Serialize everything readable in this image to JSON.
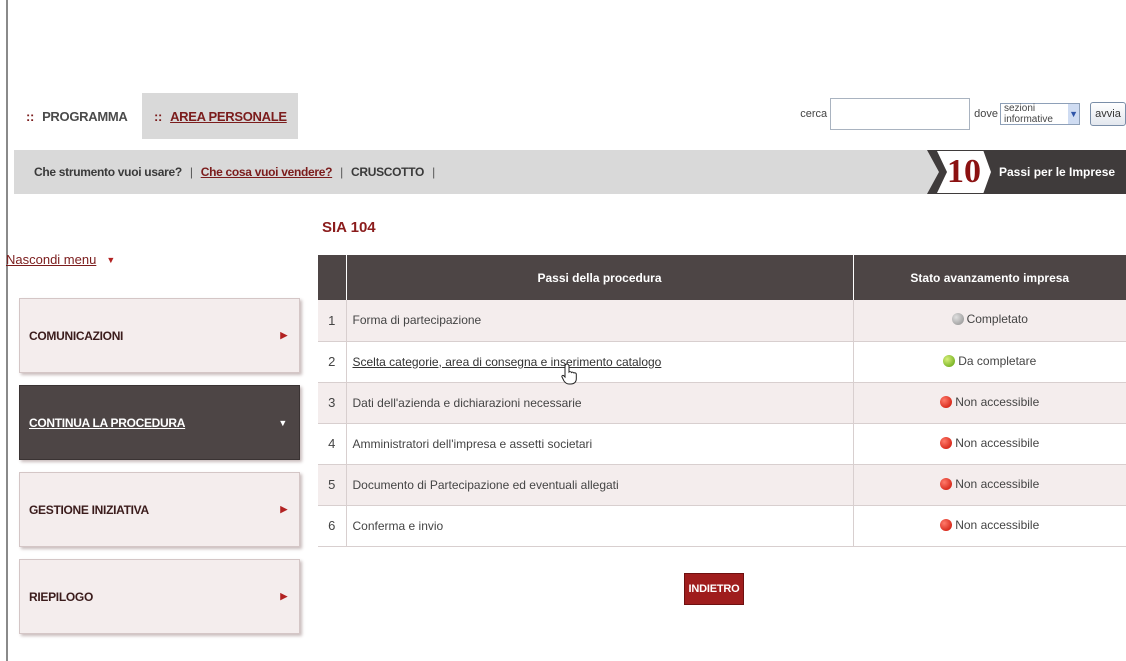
{
  "top_tabs": [
    {
      "label": "PROGRAMMA",
      "dots": "::"
    },
    {
      "label": "AREA PERSONALE",
      "dots": "::"
    }
  ],
  "search": {
    "label": "cerca",
    "value": "",
    "where_label": "dove",
    "where_value": "sezioni informative",
    "submit_label": "avvia"
  },
  "nav": {
    "links": [
      "Che strumento vuoi usare?",
      "Che cosa vuoi vendere?",
      "CRUSCOTTO"
    ],
    "separator": "|"
  },
  "banner": {
    "number": "10",
    "text": "Passi per le Imprese"
  },
  "sidebar": {
    "hide_menu_label": "Nascondi menu",
    "items": [
      {
        "label": "COMUNICAZIONI"
      },
      {
        "label": "CONTINUA LA PROCEDURA"
      },
      {
        "label": "GESTIONE INIZIATIVA"
      },
      {
        "label": "RIEPILOGO"
      }
    ]
  },
  "page_title": "SIA 104",
  "table": {
    "headers": [
      "",
      "Passi della procedura",
      "Stato avanzamento impresa"
    ],
    "rows": [
      {
        "num": "1",
        "step": "Forma di partecipazione",
        "status": "Completato",
        "status_color": "#8c8c8c"
      },
      {
        "num": "2",
        "step": "Scelta categorie, area di consegna e inserimento catalogo",
        "status": "Da completare",
        "status_color": "#5a9f0a"
      },
      {
        "num": "3",
        "step": "Dati dell'azienda e dichiarazioni necessarie",
        "status": "Non accessibile",
        "status_color": "#c90d00"
      },
      {
        "num": "4",
        "step": "Amministratori dell'impresa e assetti societari",
        "status": "Non accessibile",
        "status_color": "#c90d00"
      },
      {
        "num": "5",
        "step": "Documento di Partecipazione ed eventuali allegati",
        "status": "Non accessibile",
        "status_color": "#c90d00"
      },
      {
        "num": "6",
        "step": "Conferma e invio",
        "status": "Non accessibile",
        "status_color": "#c90d00"
      }
    ]
  },
  "back_button": "INDIETRO",
  "colors": {
    "accent": "#7b1c1c",
    "dark": "#4d4545",
    "row_alt": "#f4eded",
    "button": "#9f1d1d"
  }
}
